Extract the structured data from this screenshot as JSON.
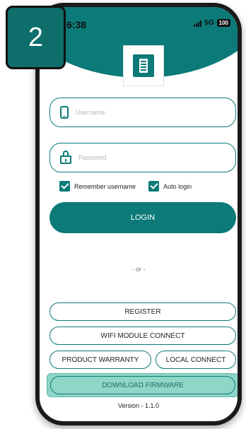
{
  "step_badge": "2",
  "status_bar": {
    "time": "6:38",
    "network": "5G",
    "battery": "100"
  },
  "login": {
    "username_placeholder": "Username",
    "password_placeholder": "Password",
    "remember_label": "Remember username",
    "auto_login_label": "Auto login",
    "login_label": "LOGIN",
    "or_text": "- or -"
  },
  "actions": {
    "register": "REGISTER",
    "wifi_connect": "WIFI MODULE CONNECT",
    "product_warranty": "PRODUCT WARRANTY",
    "local_connect": "LOCAL CONNECT",
    "download_firmware": "DOWNLOAD FIRMWARE"
  },
  "version": "Version - 1.1.0",
  "colors": {
    "accent": "#0b7a78",
    "highlight": "#8fd5c8"
  }
}
